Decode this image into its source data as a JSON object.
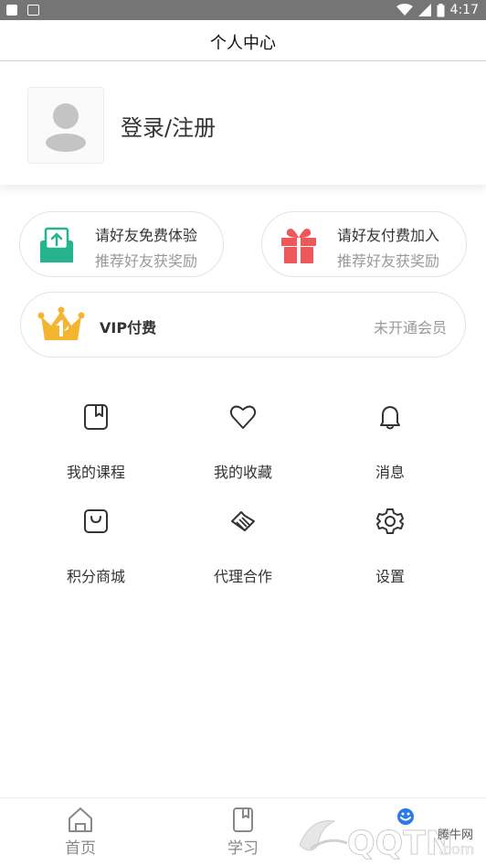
{
  "status_bar": {
    "time": "4:17"
  },
  "header": {
    "title": "个人中心"
  },
  "profile": {
    "login_label": "登录/注册"
  },
  "invite_cards": [
    {
      "title": "请好友免费体验",
      "subtitle": "推荐好友获奖励",
      "icon": "mail-upload-icon",
      "color": "#26b48f"
    },
    {
      "title": "请好友付费加入",
      "subtitle": "推荐好友获奖励",
      "icon": "gift-icon",
      "color": "#f0575a"
    }
  ],
  "vip": {
    "label": "VIP付费",
    "status": "未开通会员",
    "icon": "crown-icon",
    "color": "#f6b530"
  },
  "grid": [
    {
      "label": "我的课程",
      "icon": "book-icon"
    },
    {
      "label": "我的收藏",
      "icon": "heart-icon"
    },
    {
      "label": "消息",
      "icon": "bell-icon"
    },
    {
      "label": "积分商城",
      "icon": "shopping-bag-icon"
    },
    {
      "label": "代理合作",
      "icon": "handshake-icon"
    },
    {
      "label": "设置",
      "icon": "gear-icon"
    }
  ],
  "bottom_nav": [
    {
      "label": "首页",
      "icon": "home-icon"
    },
    {
      "label": "学习",
      "icon": "book-icon"
    },
    {
      "label": "",
      "icon": "user-icon",
      "active": true
    }
  ],
  "watermark": {
    "text": "腾牛网"
  },
  "colors": {
    "accent_blue": "#2a7be4",
    "green": "#26b48f",
    "red": "#f0575a",
    "gold": "#f6b530"
  }
}
